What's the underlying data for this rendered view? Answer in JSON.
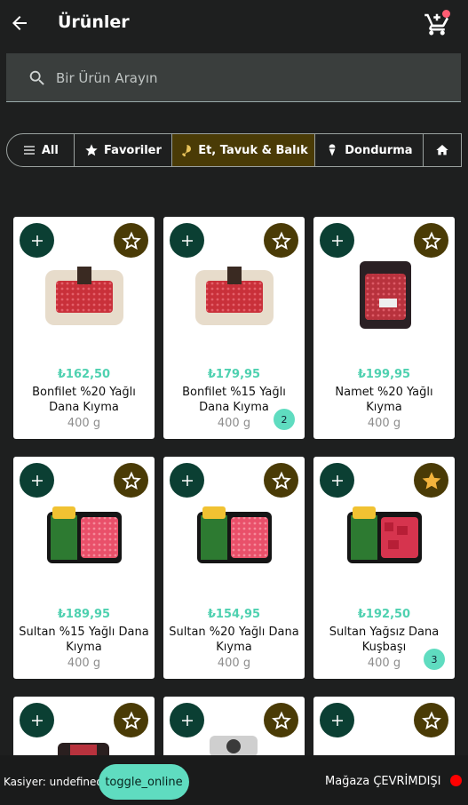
{
  "header": {
    "title": "Ürünler",
    "back_icon": "arrow-left-icon",
    "cart_icon": "cart-icon"
  },
  "search": {
    "placeholder": "Bir Ürün Arayın",
    "value": ""
  },
  "categories": [
    {
      "label": "All",
      "icon": "list-icon",
      "active": false
    },
    {
      "label": "Favoriler",
      "icon": "star-icon",
      "active": false
    },
    {
      "label": "Et, Tavuk & Balık",
      "icon": "drumstick-icon",
      "active": true
    },
    {
      "label": "Dondurma",
      "icon": "ice-cream-icon",
      "active": false
    },
    {
      "label": "",
      "icon": "home-icon",
      "active": false
    }
  ],
  "products": [
    {
      "price": "₺162,50",
      "name": "Bonfilet %20 Yağlı Dana Kıyma",
      "weight": "400 g",
      "qty": "",
      "favorite": false
    },
    {
      "price": "₺179,95",
      "name": "Bonfilet %15 Yağlı Dana Kıyma",
      "weight": "400 g",
      "qty": "2",
      "favorite": false
    },
    {
      "price": "₺199,95",
      "name": "Namet %20 Yağlı Kıyma",
      "weight": "400 g",
      "qty": "",
      "favorite": false
    },
    {
      "price": "₺189,95",
      "name": "Sultan %15 Yağlı Dana Kıyma",
      "weight": "400 g",
      "qty": "",
      "favorite": false
    },
    {
      "price": "₺154,95",
      "name": "Sultan %20 Yağlı Dana Kıyma",
      "weight": "400 g",
      "qty": "",
      "favorite": false
    },
    {
      "price": "₺192,50",
      "name": "Sultan Yağsız Dana Kuşbaşı",
      "weight": "400 g",
      "qty": "3",
      "favorite": true
    }
  ],
  "footer": {
    "cashier": "Kasiyer: undefined",
    "toggle_label": "toggle_online",
    "store_status": "Mağaza ÇEVRİMDIŞI",
    "status_color": "#ff0000"
  },
  "colors": {
    "accent": "#5fdcc0",
    "price": "#4fd1b0",
    "active_category": "#4a3b06",
    "add_button": "#0b3f33"
  }
}
